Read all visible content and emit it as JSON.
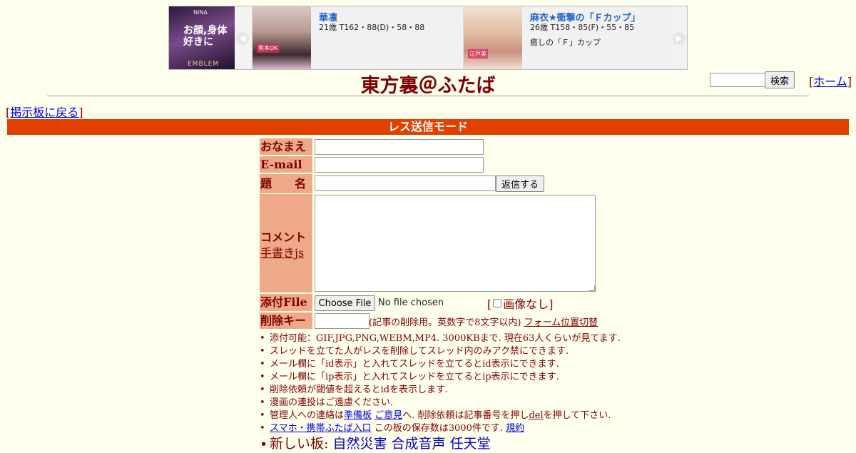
{
  "ad": {
    "logo": {
      "brand": "NINA",
      "slogan_line1": "お顔,身体",
      "slogan_line2": "好きに",
      "foot": "EMBLEM"
    },
    "prev_arrow": "◀",
    "next_arrow": "▶",
    "cards": [
      {
        "name": "華凛",
        "spec": "21歳 T162・88(D)・58・88",
        "desc": "",
        "photo_tag": "熊本OK"
      },
      {
        "name": "麻衣★衝撃の「Ｆカップ」",
        "spec": "26歳 T158・85(F)・55・85",
        "desc": "癒しの「Ｆ」カップ",
        "photo_tag": "江戸美"
      }
    ]
  },
  "header": {
    "title": "東方裏＠ふたば",
    "search_button": "検索",
    "home_bracket_open": "[",
    "home_label": "ホーム",
    "home_bracket_close": "]"
  },
  "back": {
    "open": "[",
    "label": "掲示板に戻る",
    "close": "]"
  },
  "mode_bar": "レス送信モード",
  "form": {
    "name_label": "おなまえ",
    "email_label": "E-mail",
    "subject_label": "題　　名",
    "submit_label": "返信する",
    "comment_label": "コメント",
    "handwrite_link": "手書きjs",
    "file_label": "添付File",
    "choose_file": "Choose File",
    "no_file": "No file chosen",
    "noimg_open": "[",
    "noimg_label": "画像なし]",
    "delkey_label": "削除キー",
    "delkey_note": "(記事の削除用。英数字で8文字以内)",
    "form_switch": "フォーム位置切替"
  },
  "notes": {
    "n1": "添付可能：GIF,JPG,PNG,WEBM,MP4. 3000KBまで. 現在63人くらいが見てます.",
    "n2": "スレッドを立てた人がレスを削除してスレッド内のみアク禁にできます.",
    "n3": "メール欄に「id表示」と入れてスレッドを立てるとid表示にできます.",
    "n4": "メール欄に「ip表示」と入れてスレッドを立てるとip表示にできます.",
    "n5": "削除依頼が閾値を超えるとidを表示します.",
    "n6": "漫画の連投はご遠慮ください.",
    "n7_prefix": "管理人への連絡は",
    "n7_link1": "準備板",
    "n7_link2": "ご意見",
    "n7_mid": "へ. 削除依頼は記事番号を押し",
    "n7_link3": "del",
    "n7_suffix": "を押して下さい.",
    "n8_link": "スマホ・携帯ふたば入口",
    "n8_text": "この板の保存数は3000件です.",
    "n8_link2": "規約",
    "n9_prefix": "新しい板:",
    "n9_links": [
      "自然災害",
      "合成音声",
      "任天堂"
    ]
  }
}
